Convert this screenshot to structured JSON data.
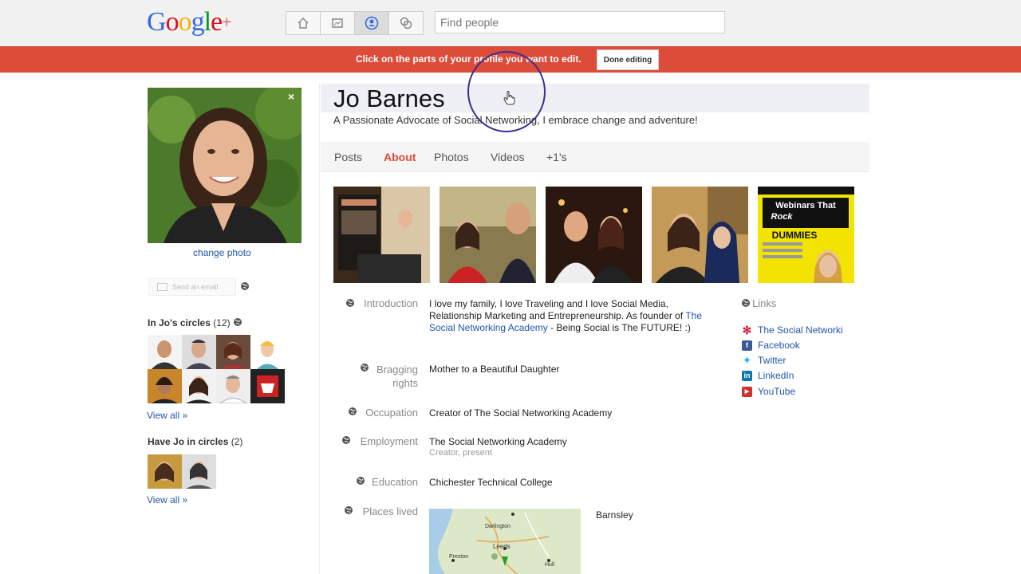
{
  "header": {
    "logo_text": "Google",
    "logo_plus": "+",
    "nav": [
      "home-icon",
      "photos-icon",
      "profile-icon",
      "circles-icon"
    ],
    "active_nav": 2,
    "search_placeholder": "Find people"
  },
  "banner": {
    "text": "Click on the parts of your profile you want to edit.",
    "done_label": "Done editing",
    "color": "#dd4b39"
  },
  "sidebar": {
    "change_photo": "change photo",
    "send_email": "Send an email",
    "in_circles_label": "In Jo's circles",
    "in_circles_count": "(12)",
    "view_all_1": "View all »",
    "have_in_circles_label": "Have Jo in circles",
    "have_in_circles_count": "(2)",
    "view_all_2": "View all »"
  },
  "profile": {
    "name": "Jo Barnes",
    "tagline": "A Passionate Advocate of Social Networking, I embrace change and adventure!"
  },
  "tabs": [
    "Posts",
    "About",
    "Photos",
    "Videos",
    "+1's"
  ],
  "active_tab": "About",
  "thumbs": {
    "book_title_1": "Webinars That",
    "book_title_2": "Rock",
    "book_title_3": "FOR",
    "book_title_4": "DUMMIES"
  },
  "about": {
    "introduction_label": "Introduction",
    "introduction_text_1": "I love my family, I love Traveling and I love Social Media,",
    "introduction_text_2": "Relationship Marketing and Entrepreneurship. As founder of",
    "introduction_link_1": "The",
    "introduction_link_2": "Social Networking Academy",
    "introduction_text_3": " - Being Social is The FUTURE! :)",
    "bragging_label_1": "Bragging",
    "bragging_label_2": "rights",
    "bragging_value": "Mother to a Beautiful Daughter",
    "occupation_label": "Occupation",
    "occupation_value": "Creator of The Social Networking Academy",
    "employment_label": "Employment",
    "employment_value": "The Social Networking Academy",
    "employment_sub": "Creator, present",
    "education_label": "Education",
    "education_value": "Chichester Technical College",
    "places_label": "Places lived",
    "places_value": "Barnsley",
    "map_labels": [
      "Darlington",
      "Preston",
      "Leeds",
      "Hull"
    ]
  },
  "links": {
    "title": "Links",
    "items": [
      {
        "label": "The Social Networki",
        "icon": "academy-icon",
        "color": "#cc2244"
      },
      {
        "label": "Facebook",
        "icon": "facebook-icon",
        "color": "#3b5998"
      },
      {
        "label": "Twitter",
        "icon": "twitter-icon",
        "color": "#33aaee"
      },
      {
        "label": "LinkedIn",
        "icon": "linkedin-icon",
        "color": "#0e76a8"
      },
      {
        "label": "YouTube",
        "icon": "youtube-icon",
        "color": "#cc3333"
      }
    ]
  }
}
